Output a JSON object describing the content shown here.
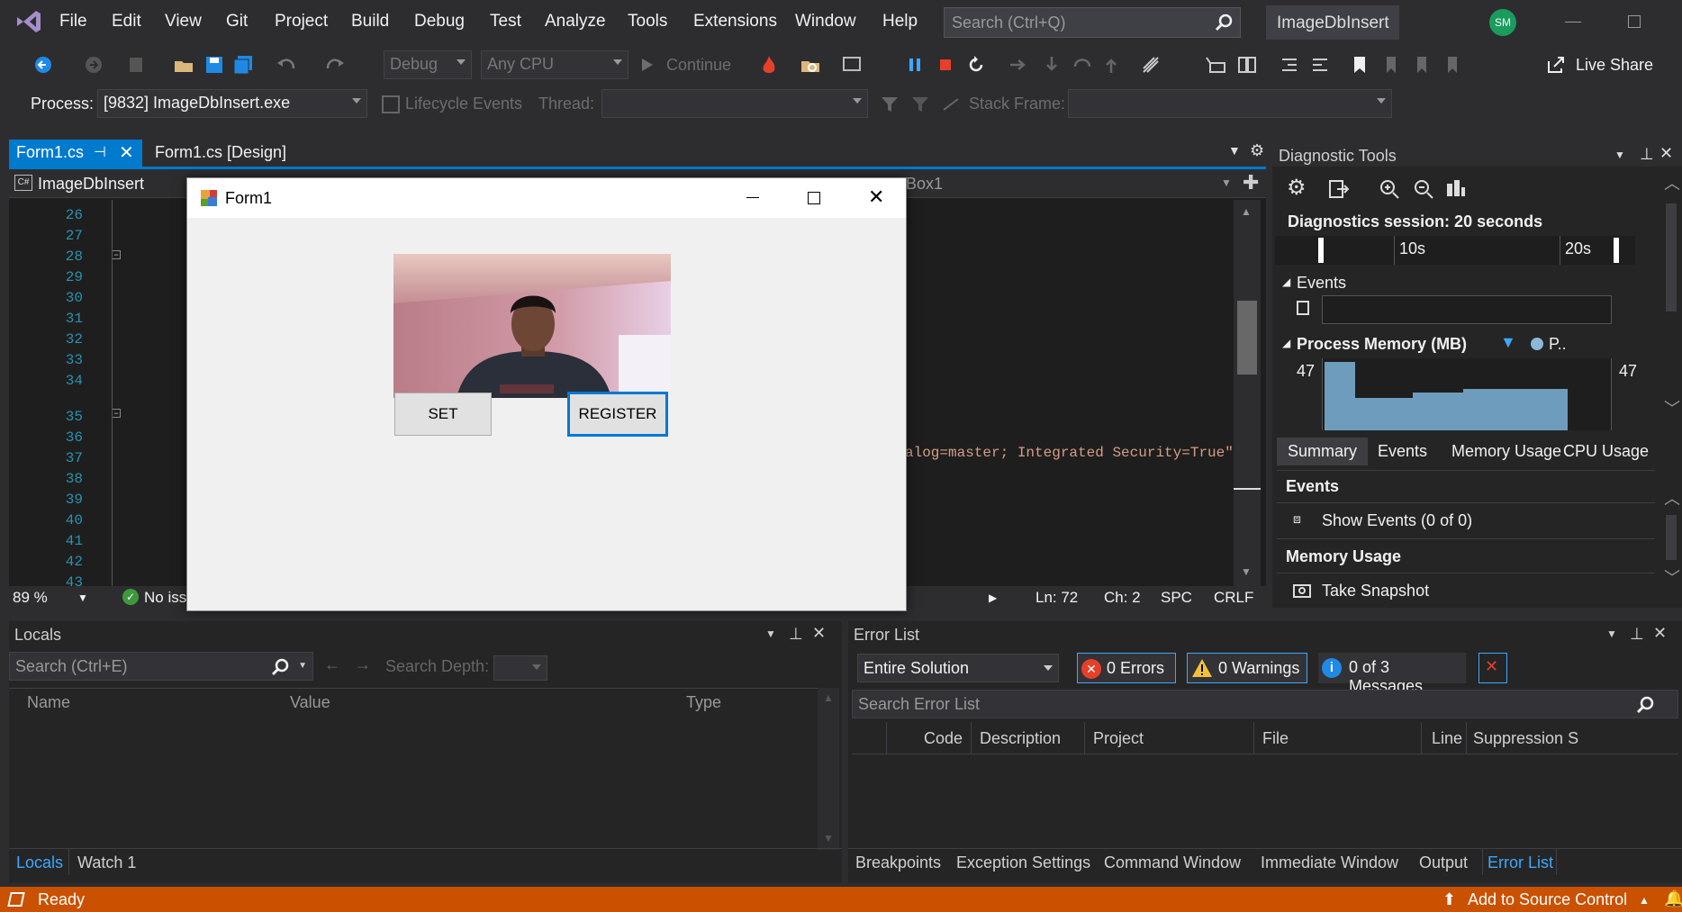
{
  "menu": [
    "File",
    "Edit",
    "View",
    "Git",
    "Project",
    "Build",
    "Debug",
    "Test",
    "Analyze",
    "Tools",
    "Extensions",
    "Window",
    "Help"
  ],
  "search_placeholder": "Search (Ctrl+Q)",
  "solution_name": "ImageDbInsert",
  "avatar_initials": "SM",
  "toolbar": {
    "config": "Debug",
    "platform": "Any CPU",
    "continue": "Continue",
    "live_share": "Live Share",
    "process_label": "Process:",
    "process_value": "[9832] ImageDbInsert.exe",
    "lifecycle": "Lifecycle Events",
    "thread_label": "Thread:",
    "stack_label": "Stack Frame:"
  },
  "doc_tabs": [
    {
      "label": "Form1.cs"
    },
    {
      "label": "Form1.cs [Design]"
    }
  ],
  "nav": {
    "project": "ImageDbInsert",
    "member": "Box1"
  },
  "line_numbers": [
    "26",
    "27",
    "28",
    "29",
    "30",
    "31",
    "32",
    "33",
    "34",
    "35",
    "36",
    "37",
    "38",
    "39",
    "40",
    "41",
    "42",
    "43"
  ],
  "code_fragment": "alog=master; Integrated Security=True\"",
  "editor_status": {
    "zoom": "89 %",
    "issues": "No iss",
    "ln": "Ln: 72",
    "ch": "Ch: 2",
    "spc": "SPC",
    "crlf": "CRLF"
  },
  "form1": {
    "title": "Form1",
    "set_button": "SET",
    "register_button": "REGISTER"
  },
  "diag": {
    "title": "Diagnostic Tools",
    "session": "Diagnostics session: 20 seconds",
    "tick_10": "10s",
    "tick_20": "20s",
    "events_label": "Events",
    "memory_label": "Process Memory (MB)",
    "memory_legend": "P..",
    "mem_left": "47",
    "mem_right": "47",
    "tabs": [
      "Summary",
      "Events",
      "Memory Usage",
      "CPU Usage"
    ],
    "events_section": "Events",
    "show_events": "Show Events (0 of 0)",
    "memory_section": "Memory Usage",
    "take_snapshot": "Take Snapshot"
  },
  "locals": {
    "title": "Locals",
    "search_placeholder": "Search (Ctrl+E)",
    "search_depth": "Search Depth:",
    "cols": [
      "Name",
      "Value",
      "Type"
    ],
    "tabs": [
      "Locals",
      "Watch 1"
    ]
  },
  "errorlist": {
    "title": "Error List",
    "scope": "Entire Solution",
    "errors": "0 Errors",
    "warnings": "0 Warnings",
    "messages": "0 of 3 Messages",
    "search_placeholder": "Search Error List",
    "cols": [
      "Code",
      "Description",
      "Project",
      "File",
      "Line",
      "Suppression S"
    ],
    "bottom_tabs": [
      "Breakpoints",
      "Exception Settings",
      "Command Window",
      "Immediate Window",
      "Output",
      "Error List"
    ]
  },
  "status": {
    "ready": "Ready",
    "source_control": "Add to Source Control"
  },
  "colors": {
    "accent": "#007acc",
    "status_bar": "#ca5100",
    "background": "#2d2d30"
  }
}
